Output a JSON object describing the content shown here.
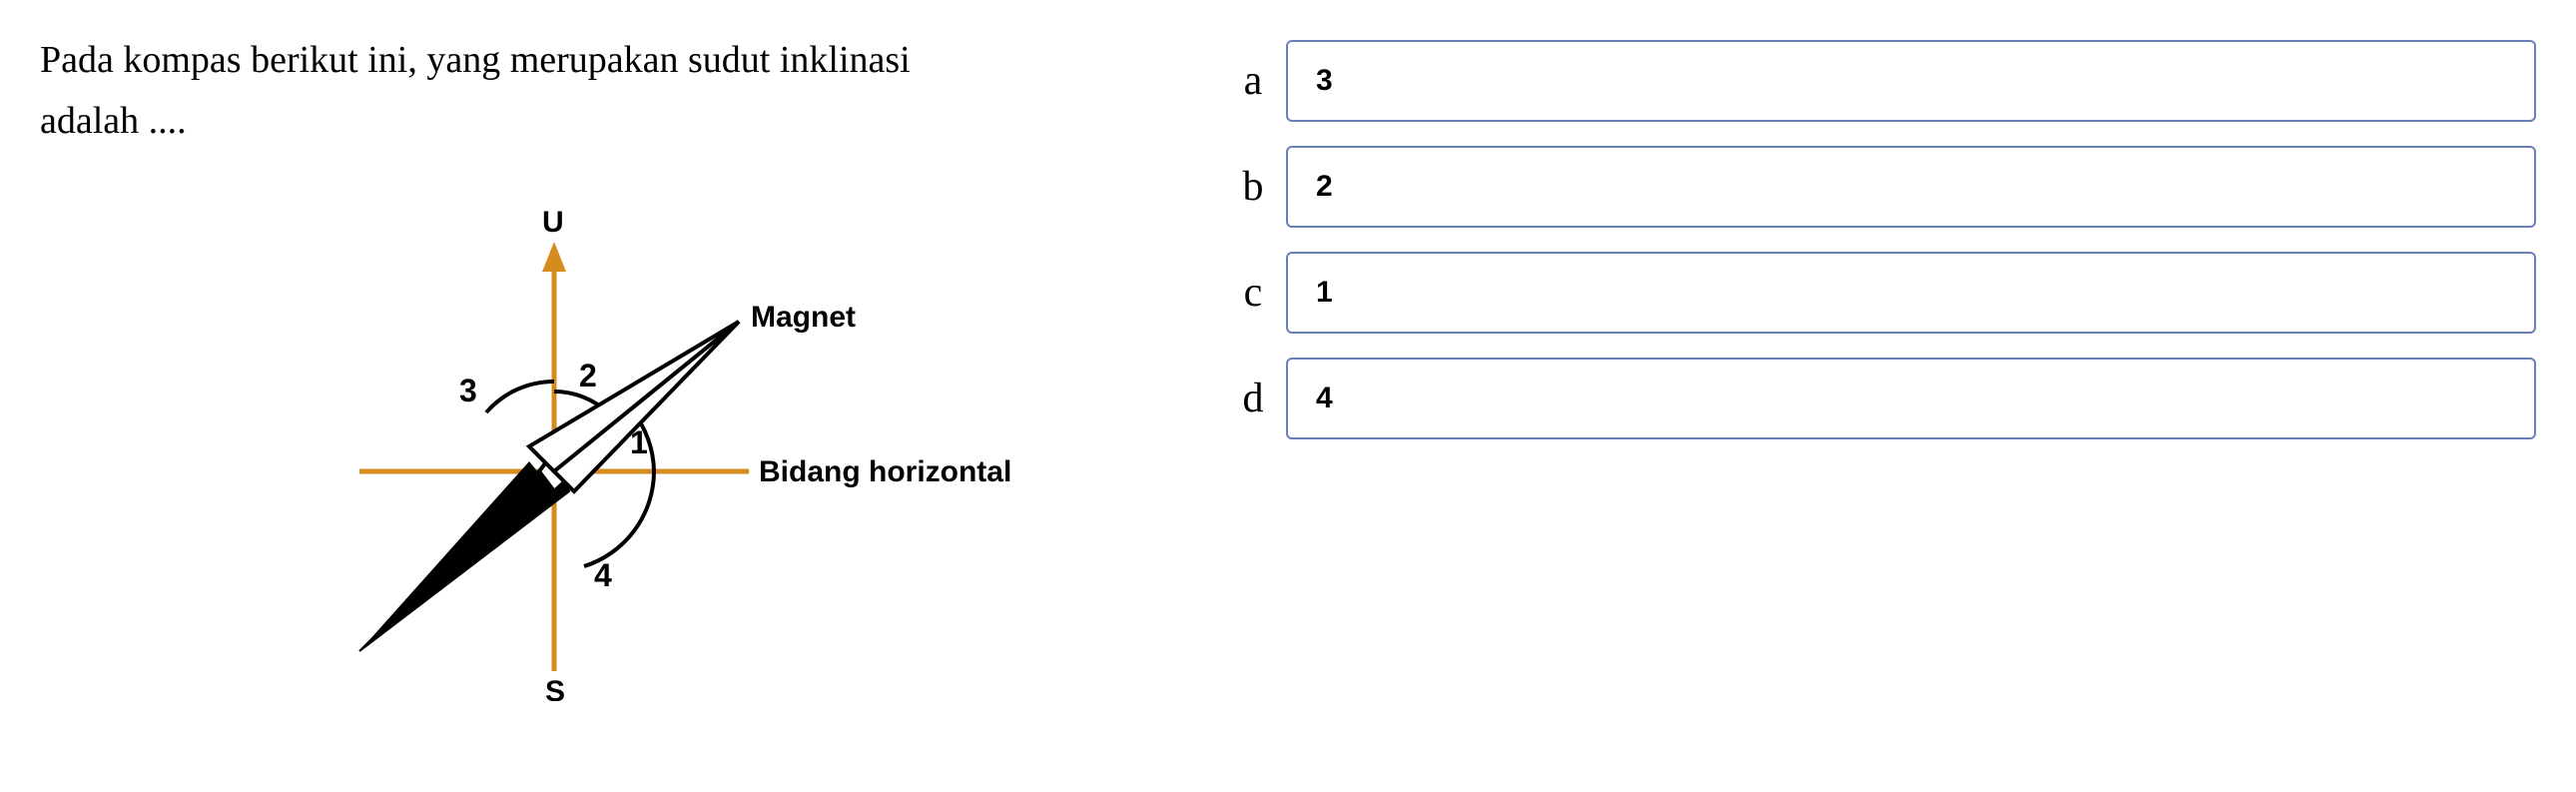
{
  "question": {
    "line1": "Pada kompas berikut ini, yang merupakan sudut inklinasi",
    "line2": "adalah ...."
  },
  "diagram": {
    "label_top": "U",
    "label_bottom": "S",
    "label_magnet": "Magnet",
    "label_horizontal": "Bidang horizontal",
    "angle_1": "1",
    "angle_2": "2",
    "angle_3": "3",
    "angle_4": "4"
  },
  "options": {
    "a": {
      "letter": "a",
      "text": "3"
    },
    "b": {
      "letter": "b",
      "text": "2"
    },
    "c": {
      "letter": "c",
      "text": "1"
    },
    "d": {
      "letter": "d",
      "text": "4"
    }
  }
}
